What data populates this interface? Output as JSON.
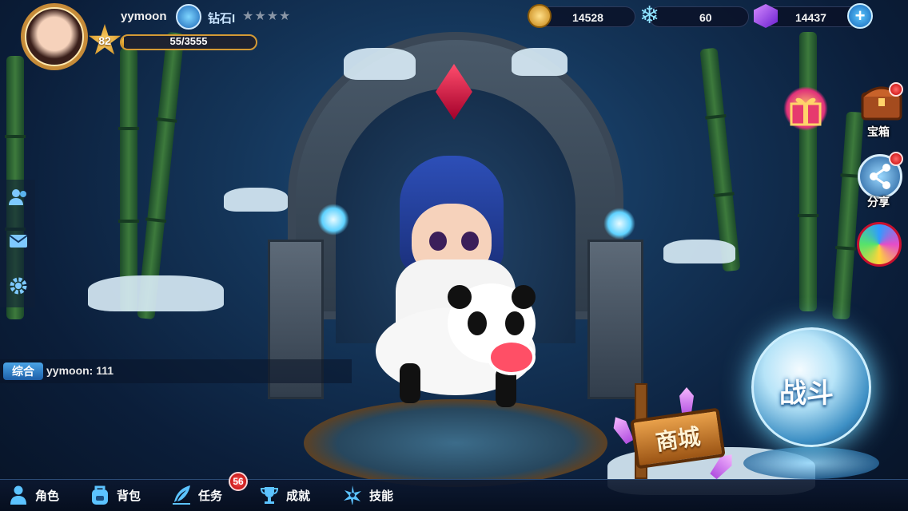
{
  "player": {
    "name": "yymoon",
    "level": "82",
    "exp_text": "55/3555",
    "exp_fraction": 0.016,
    "rank_name": "钻石I",
    "rank_stars": "★★★★"
  },
  "resources": {
    "gold": "14528",
    "snowflake": "60",
    "gems": "14437"
  },
  "chat": {
    "channel": "综合",
    "message": "yymoon: 111"
  },
  "right_menu": {
    "treasure": "宝箱",
    "share": "分享"
  },
  "bottom_nav": [
    {
      "label": "角色",
      "icon": "person-icon"
    },
    {
      "label": "背包",
      "icon": "backpack-icon"
    },
    {
      "label": "任务",
      "icon": "quill-icon",
      "badge": "56"
    },
    {
      "label": "成就",
      "icon": "trophy-icon"
    },
    {
      "label": "技能",
      "icon": "spark-icon"
    }
  ],
  "shop_label": "商城",
  "battle_label": "战斗",
  "colors": {
    "accent": "#5cc3ff",
    "gold": "#d49a35",
    "badge_red": "#c40000"
  }
}
